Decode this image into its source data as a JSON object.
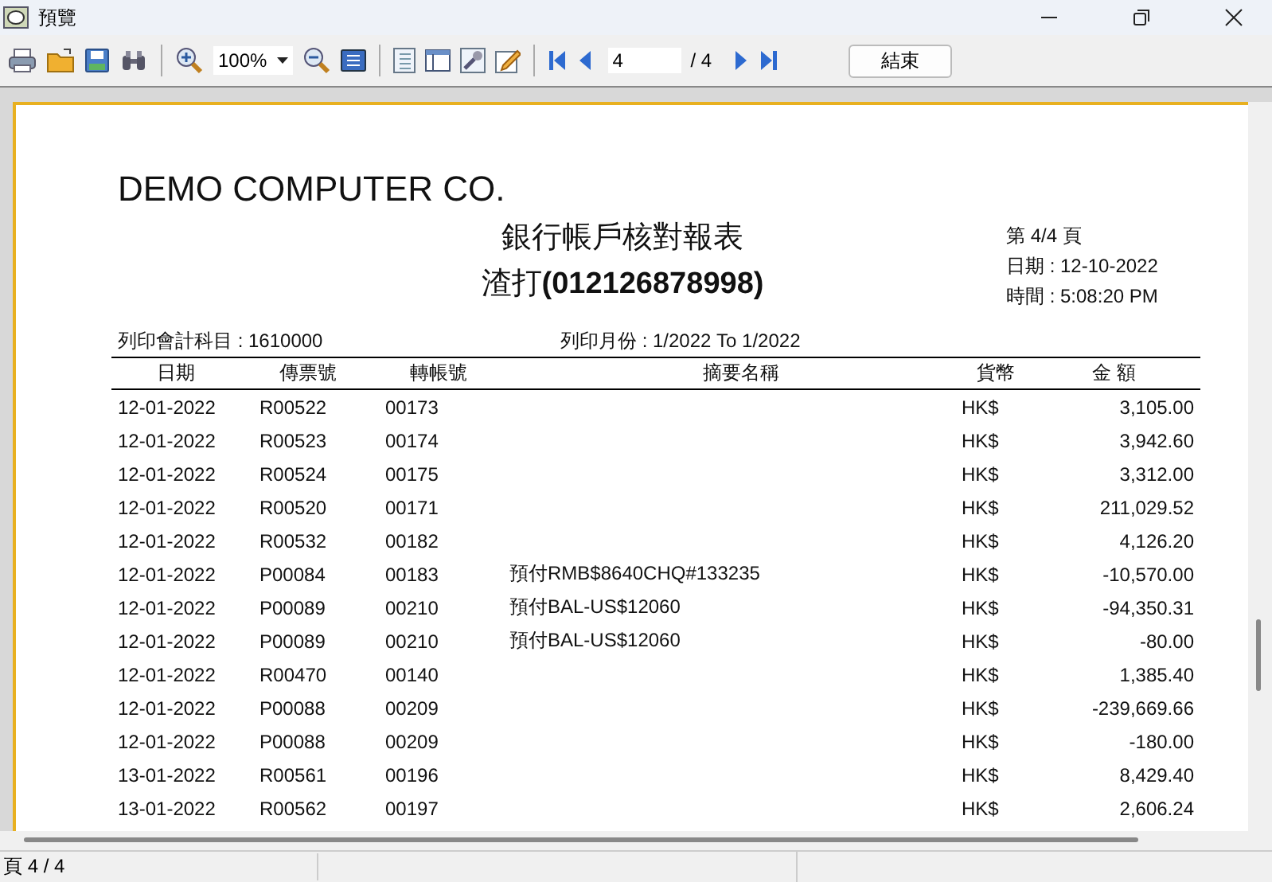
{
  "window": {
    "title": "預覽"
  },
  "toolbar": {
    "zoom": "100%",
    "page_input": "4",
    "page_total": "/ 4",
    "close_button": "結束"
  },
  "report": {
    "company": "DEMO COMPUTER CO.",
    "title": "銀行帳戶核對報表",
    "subtitle_prefix": "渣打",
    "subtitle_number": "(012126878998)",
    "page_info": "第 4/4 頁",
    "date": "日期 : 12-10-2022",
    "time": "時間 : 5:08:20 PM",
    "account": "列印會計科目 : 1610000",
    "month_range": "列印月份 : 1/2022 To 1/2022",
    "columns": [
      "日期",
      "傳票號",
      "轉帳號",
      "摘要名稱",
      "貨幣",
      "金 額"
    ],
    "rows": [
      [
        "12-01-2022",
        "R00522",
        "00173",
        "",
        "HK$",
        "3,105.00"
      ],
      [
        "12-01-2022",
        "R00523",
        "00174",
        "",
        "HK$",
        "3,942.60"
      ],
      [
        "12-01-2022",
        "R00524",
        "00175",
        "",
        "HK$",
        "3,312.00"
      ],
      [
        "12-01-2022",
        "R00520",
        "00171",
        "",
        "HK$",
        "211,029.52"
      ],
      [
        "12-01-2022",
        "R00532",
        "00182",
        "",
        "HK$",
        "4,126.20"
      ],
      [
        "12-01-2022",
        "P00084",
        "00183",
        "預付RMB$8640CHQ#133235",
        "HK$",
        "-10,570.00"
      ],
      [
        "12-01-2022",
        "P00089",
        "00210",
        "預付BAL-US$12060",
        "HK$",
        "-94,350.31"
      ],
      [
        "12-01-2022",
        "P00089",
        "00210",
        "預付BAL-US$12060",
        "HK$",
        "-80.00"
      ],
      [
        "12-01-2022",
        "R00470",
        "00140",
        "",
        "HK$",
        "1,385.40"
      ],
      [
        "12-01-2022",
        "P00088",
        "00209",
        "",
        "HK$",
        "-239,669.66"
      ],
      [
        "12-01-2022",
        "P00088",
        "00209",
        "",
        "HK$",
        "-180.00"
      ],
      [
        "13-01-2022",
        "R00561",
        "00196",
        "",
        "HK$",
        "8,429.40"
      ],
      [
        "13-01-2022",
        "R00562",
        "00197",
        "",
        "HK$",
        "2,606.24"
      ]
    ]
  },
  "status_bar": {
    "page": "頁 4 / 4"
  }
}
